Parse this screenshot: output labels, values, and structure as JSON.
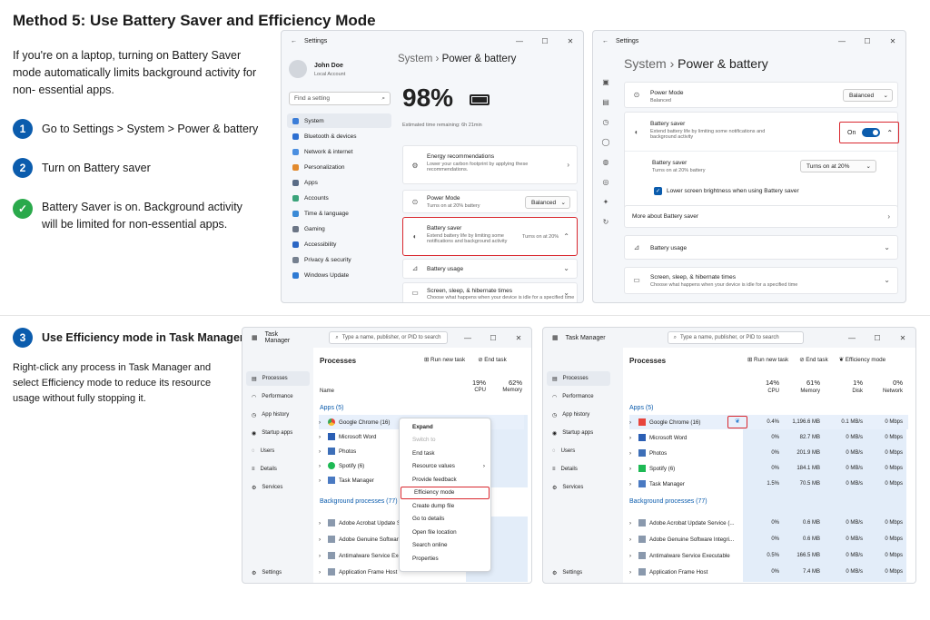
{
  "method_title": "Method 5: Use Battery Saver and Efficiency Mode",
  "intro": "If you're on a laptop, turning on Battery Saver mode automatically limits background activity for non- essential apps.",
  "steps": [
    {
      "num": "1",
      "text": "Go to Settings > System > Power & battery"
    },
    {
      "num": "2",
      "text": "Turn on Battery saver"
    },
    {
      "num": "✓",
      "text": "Battery Saver is on. Background activity will be limited for non-essential apps."
    },
    {
      "num": "3",
      "text": "Use Efficiency mode in Task Manager"
    }
  ],
  "step3_desc": "Right-click any process in Task Manager and select Efficiency mode to reduce its resource usage without fully stopping it.",
  "settings1": {
    "window_title": "Settings",
    "user_name": "John Doe",
    "user_sub": "Local Account",
    "search_placeholder": "Find a setting",
    "nav": [
      "System",
      "Bluetooth & devices",
      "Network & internet",
      "Personalization",
      "Apps",
      "Accounts",
      "Time & language",
      "Gaming",
      "Accessibility",
      "Privacy & security",
      "Windows Update"
    ],
    "breadcrumb_root": "System",
    "breadcrumb_page": "Power & battery",
    "battery_pct": "98%",
    "est": "Estimated time remaining: 6h 21min",
    "energy_title": "Energy recommendations",
    "energy_sub": "Lower your carbon footprint by applying these recommendations.",
    "power_mode": "Power Mode",
    "power_mode_sub": "Turns on at 20% battery",
    "power_mode_val": "Balanced",
    "bs_title": "Battery saver",
    "bs_sub": "Extend battery life by limiting some notifications and background activity",
    "bs_val": "Turns on at 20%",
    "usage": "Battery usage",
    "screen": "Screen, sleep, & hibernate times",
    "screen_sub": "Choose what happens when your device is idle for a specified time"
  },
  "settings2": {
    "window_title": "Settings",
    "breadcrumb_root": "System",
    "breadcrumb_page": "Power & battery",
    "power_mode": "Power Mode",
    "power_mode_sub": "Balanced",
    "power_mode_val": "Balanced",
    "bs_title": "Battery saver",
    "bs_sub": "Extend battery life by limiting some notifications and background activity",
    "bs_state": "On",
    "bs2_title": "Battery saver",
    "bs2_sub": "Turns on at 20% battery",
    "bs2_val": "Turns on at 20%",
    "lower": "Lower screen brightness when using Battery saver",
    "more": "More about Battery saver",
    "usage": "Battery usage",
    "screen": "Screen, sleep, & hibernate times",
    "screen_sub": "Choose what happens when your device is idle for a specified time"
  },
  "tm": {
    "window_title": "Task Manager",
    "search_placeholder": "Type a name, publisher, or PID to search",
    "nav": [
      "Processes",
      "Performance",
      "App history",
      "Startup apps",
      "Users",
      "Details",
      "Services"
    ],
    "settings": "Settings",
    "header": "Processes",
    "run": "Run new task",
    "end": "End task",
    "eff": "Efficiency mode",
    "cpu_pct": "19%",
    "mem_pct": "62%",
    "cpu": "CPU",
    "mem": "Memory",
    "name_col": "Name",
    "apps_group": "Apps (5)",
    "bg_group": "Background processes (77)",
    "apps": [
      "Google Chrome (16)",
      "Microsoft Word",
      "Photos",
      "Spotify (6)",
      "Task Manager"
    ],
    "bg": [
      "Adobe Acrobat Update Service (...",
      "Adobe Genuine Software Integri...",
      "Antimalware Service Executable",
      "Application Frame Host"
    ],
    "bg1": [
      "Adobe Acrobat Update Se",
      "Adobe Genuine Software",
      "Antimalware Service Executa",
      "Application Frame Host"
    ],
    "menu": [
      "Expand",
      "Switch to",
      "End task",
      "Resource values",
      "Provide feedback",
      "Efficiency mode",
      "Create dump file",
      "Go to details",
      "Open file location",
      "Search online",
      "Properties"
    ]
  },
  "tm2": {
    "cpu_pct": "14%",
    "mem_pct": "61%",
    "disk_pct": "1%",
    "net_pct": "0%",
    "cpu": "CPU",
    "mem": "Memory",
    "disk": "Disk",
    "net": "Network",
    "app_cpu": [
      "0.4%",
      "0%",
      "0%",
      "0%",
      "1.5%"
    ],
    "app_mem": [
      "1,196.6 MB",
      "82.7 MB",
      "201.9 MB",
      "184.1 MB",
      "70.5 MB"
    ],
    "app_disk": [
      "0.1 MB/s",
      "0 MB/s",
      "0 MB/s",
      "0 MB/s",
      "0 MB/s"
    ],
    "app_net": [
      "0 Mbps",
      "0 Mbps",
      "0 Mbps",
      "0 Mbps",
      "0 Mbps"
    ],
    "bg_cpu": [
      "0%",
      "0%",
      "0.5%",
      "0%"
    ],
    "bg_mem": [
      "0.6 MB",
      "0.6 MB",
      "166.5 MB",
      "7.4 MB"
    ],
    "bg_disk": [
      "0 MB/s",
      "0 MB/s",
      "0 MB/s",
      "0 MB/s"
    ],
    "bg_net": [
      "0 Mbps",
      "0 Mbps",
      "0 Mbps",
      "0 Mbps"
    ]
  },
  "colors": {
    "accent": "#0b5cad",
    "highlight": "#d9272e",
    "check": "#2aa94b"
  }
}
